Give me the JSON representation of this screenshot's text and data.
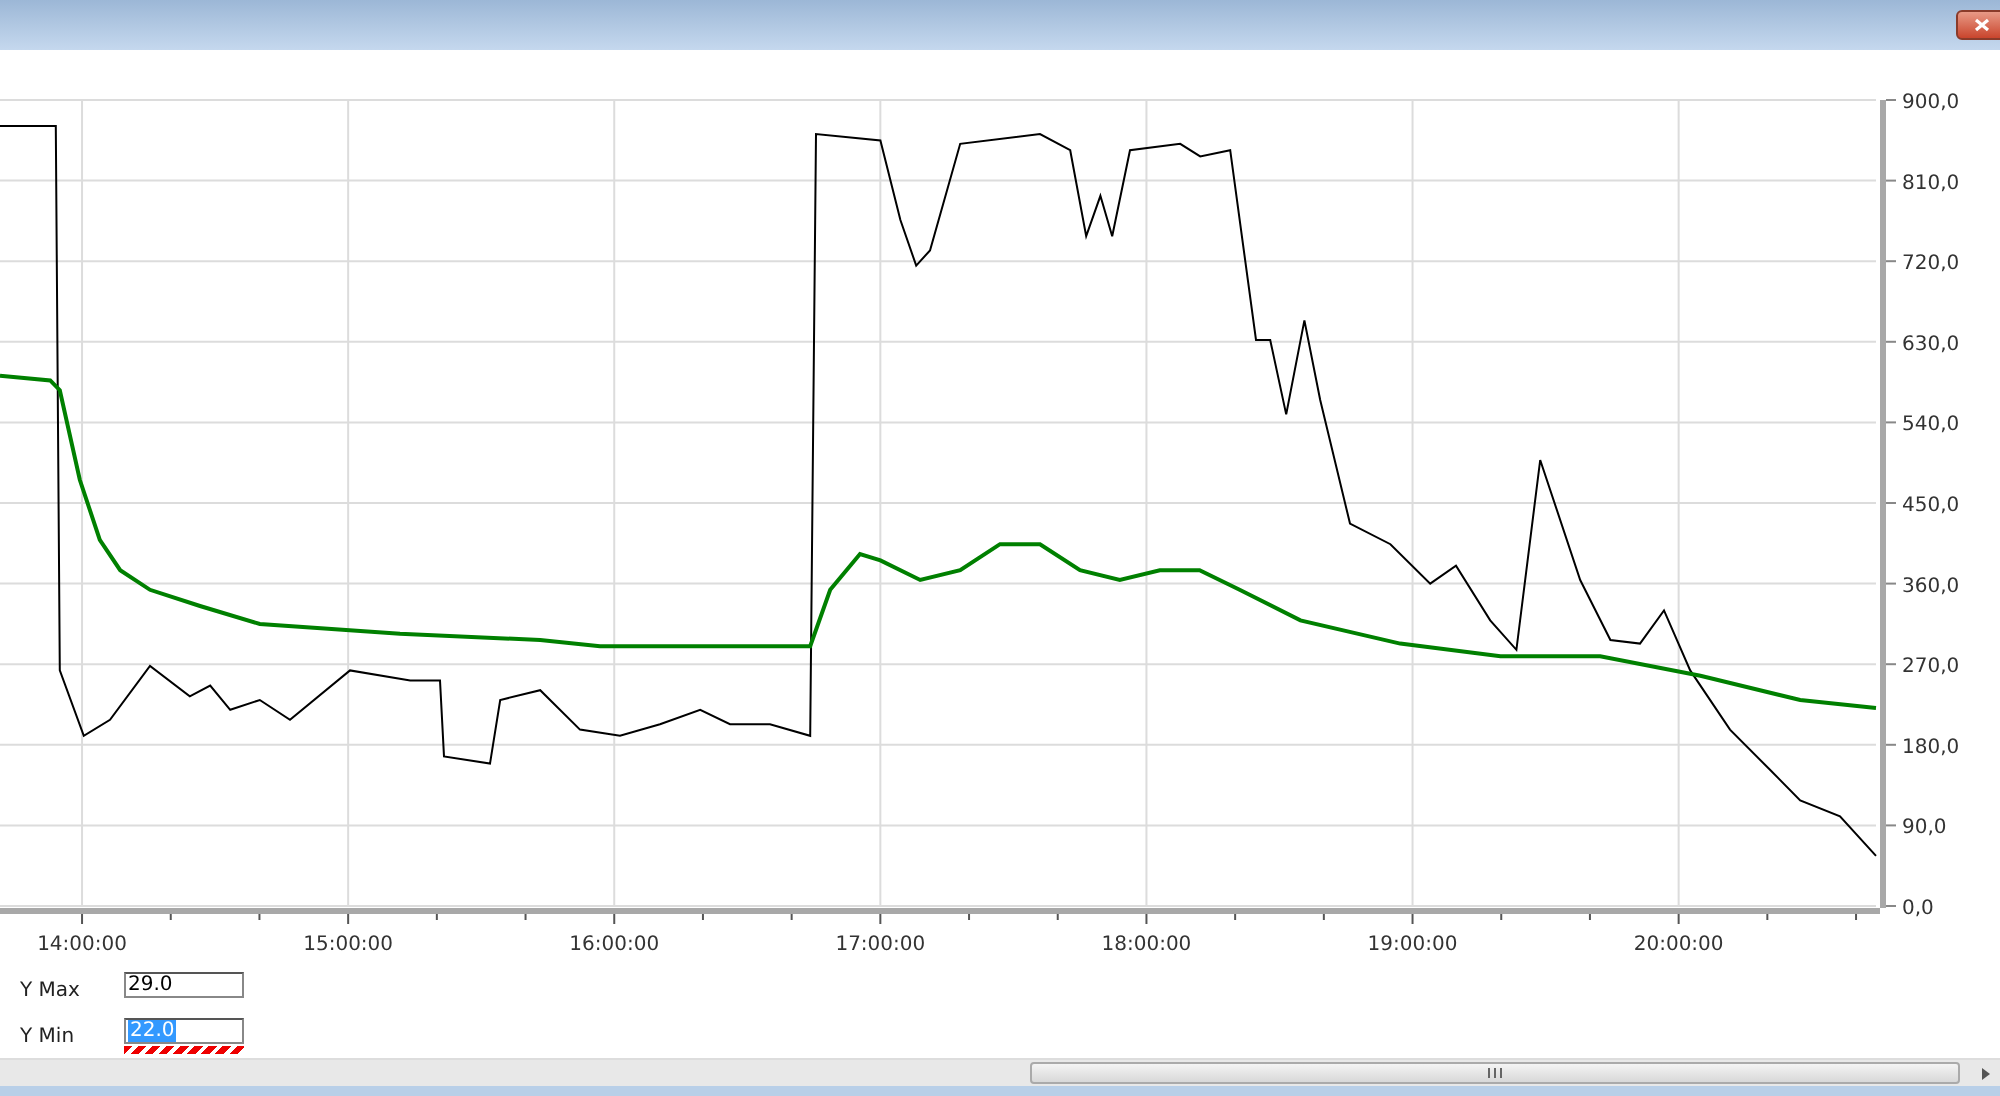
{
  "chart": {
    "chart_data": {
      "type": "line",
      "grid": true,
      "xlim": [
        821.5,
        1244.5
      ],
      "ylim": [
        0,
        900
      ],
      "xticks": [
        {
          "value": 840,
          "label": "14:00:00"
        },
        {
          "value": 900,
          "label": "15:00:00"
        },
        {
          "value": 960,
          "label": "16:00:00"
        },
        {
          "value": 1020,
          "label": "17:00:00"
        },
        {
          "value": 1080,
          "label": "18:00:00"
        },
        {
          "value": 1140,
          "label": "19:00:00"
        },
        {
          "value": 1200,
          "label": "20:00:00"
        }
      ],
      "yticks": [
        {
          "value": 0,
          "label": "0,0"
        },
        {
          "value": 90,
          "label": "90,0"
        },
        {
          "value": 180,
          "label": "180,0"
        },
        {
          "value": 270,
          "label": "270,0"
        },
        {
          "value": 360,
          "label": "360,0"
        },
        {
          "value": 450,
          "label": "450,0"
        },
        {
          "value": 540,
          "label": "540,0"
        },
        {
          "value": 630,
          "label": "630,0"
        },
        {
          "value": 720,
          "label": "720,0"
        },
        {
          "value": 810,
          "label": "810,0"
        },
        {
          "value": 900,
          "label": "900,0"
        }
      ],
      "series": [
        {
          "color": "#000000",
          "x": [
            821.5,
            834.1,
            835,
            840.4,
            846.3,
            855.3,
            864.3,
            868.9,
            873.4,
            880.1,
            886.9,
            900.4,
            914,
            920.7,
            921.6,
            932,
            934.3,
            943.3,
            952.3,
            961.3,
            970.3,
            979.4,
            986.1,
            995.1,
            1004.2,
            1005.5,
            1020,
            1024.5,
            1028.1,
            1031.2,
            1038,
            1056,
            1062.8,
            1066.4,
            1069.6,
            1072.3,
            1076.3,
            1087.6,
            1092.1,
            1098.9,
            1104.7,
            1107.9,
            1111.5,
            1115.6,
            1119.2,
            1125.9,
            1135,
            1144,
            1149.8,
            1157.5,
            1163.4,
            1168.8,
            1177.8,
            1184.6,
            1191.3,
            1196.7,
            1202.6,
            1211.6,
            1220.6,
            1227.4,
            1236.4,
            1244.5
          ],
          "values": [
            871,
            871,
            263,
            190,
            208,
            268,
            234,
            246,
            219,
            230,
            208,
            263,
            252,
            252,
            167,
            159,
            230,
            241,
            197,
            190,
            203,
            219,
            203,
            203,
            190,
            862,
            855,
            766,
            715,
            732,
            851,
            862,
            844,
            748,
            793,
            748,
            844,
            851,
            837,
            844,
            632,
            632,
            549,
            654,
            565,
            427,
            404,
            360,
            380,
            319,
            286,
            498,
            364,
            297,
            293,
            330,
            263,
            197,
            152,
            118,
            100,
            56
          ]
        },
        {
          "color": "#008000",
          "x": [
            821.5,
            832.8,
            835,
            839.5,
            844,
            848.6,
            855.3,
            866.6,
            880.1,
            911.7,
            943.3,
            956.8,
            992.9,
            1004.2,
            1008.7,
            1015.4,
            1020,
            1029,
            1038,
            1047,
            1056,
            1065,
            1074,
            1083,
            1092,
            1101,
            1114.7,
            1137.2,
            1159.8,
            1182.3,
            1204.9,
            1227.4,
            1244.5
          ],
          "values": [
            592,
            587,
            576,
            476,
            409,
            375,
            353,
            335,
            315,
            304,
            297,
            290,
            290,
            290,
            353,
            393,
            386,
            364,
            375,
            404,
            404,
            375,
            364,
            375,
            375,
            353,
            319,
            293,
            279,
            279,
            257,
            230,
            221
          ]
        }
      ]
    }
  },
  "fields": [
    {
      "label": "Y Max",
      "value": "29.0",
      "selected": false,
      "error": false
    },
    {
      "label": "Y Min",
      "value": "22.0",
      "selected": true,
      "error": true
    }
  ]
}
